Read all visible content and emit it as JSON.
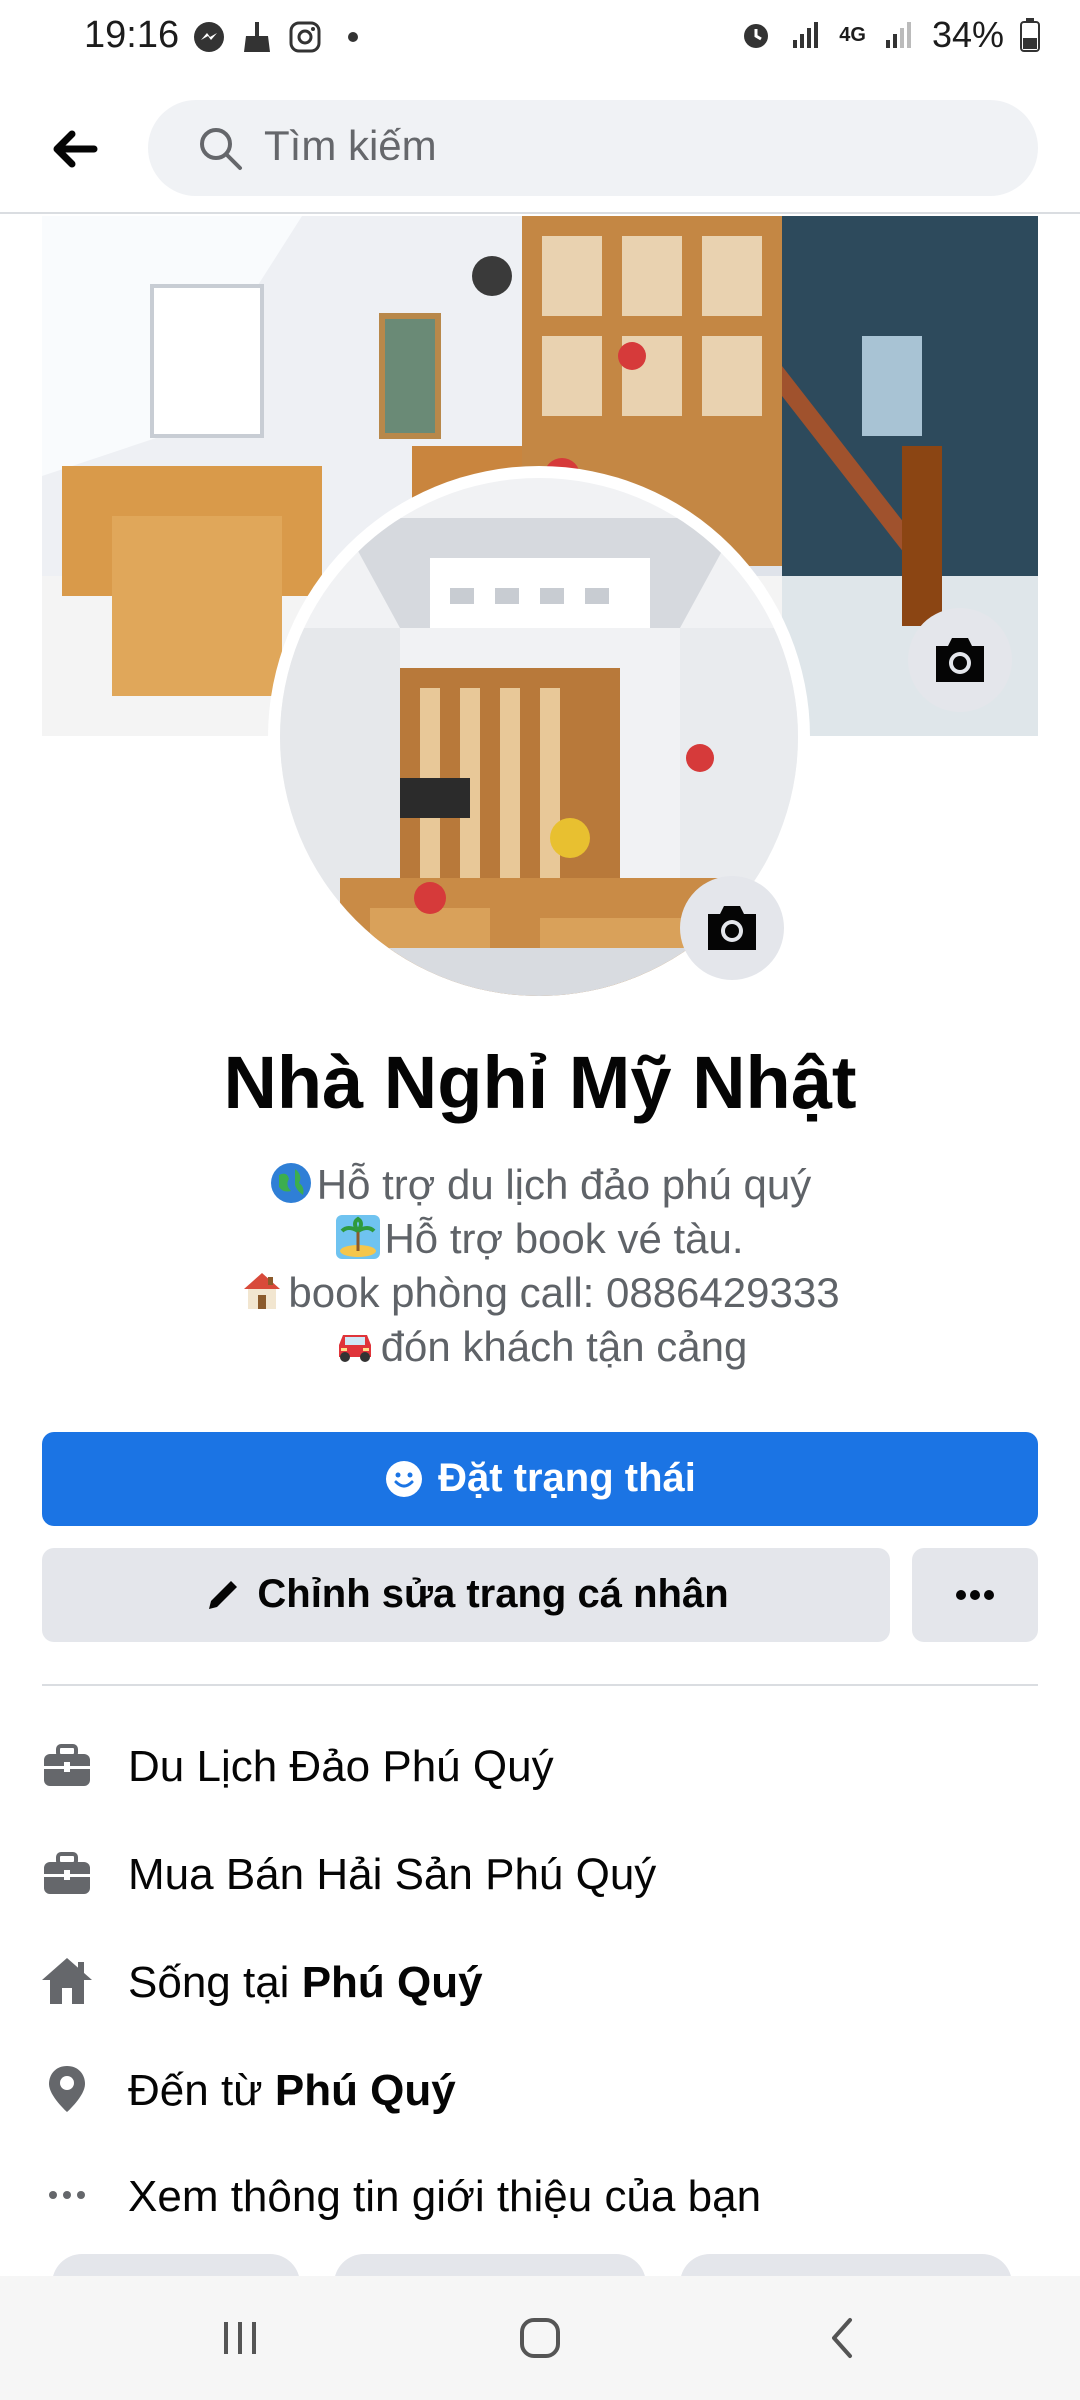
{
  "status_bar": {
    "time": "19:16",
    "battery": "34%",
    "network": "4G"
  },
  "header": {
    "search_placeholder": "Tìm kiếm"
  },
  "profile": {
    "name": "Nhà Nghỉ Mỹ Nhật",
    "bio": [
      {
        "emoji": "globe-icon",
        "text": "Hỗ trợ du lịch đảo phú quý"
      },
      {
        "emoji": "island-icon",
        "text": "Hỗ trợ book vé tàu."
      },
      {
        "emoji": "house-icon",
        "text": "book phòng call: 0886429333"
      },
      {
        "emoji": "car-icon",
        "text": "đón khách tận cảng"
      }
    ]
  },
  "actions": {
    "status_button": "Đặt trạng thái",
    "edit_button": "Chỉnh sửa trang cá nhân",
    "more_button": "•••"
  },
  "info": {
    "work1": "Du Lịch Đảo Phú Quý",
    "work2": "Mua Bán Hải Sản Phú Quý",
    "lives_prefix": "Sống tại ",
    "lives_place": "Phú Quý",
    "from_prefix": "Đến từ ",
    "from_place": "Phú Quý",
    "see_about": "Xem thông tin giới thiệu của bạn"
  },
  "colors": {
    "primary": "#1b74e4",
    "button_gray": "#e4e6eb",
    "secondary_text": "#65676b"
  }
}
